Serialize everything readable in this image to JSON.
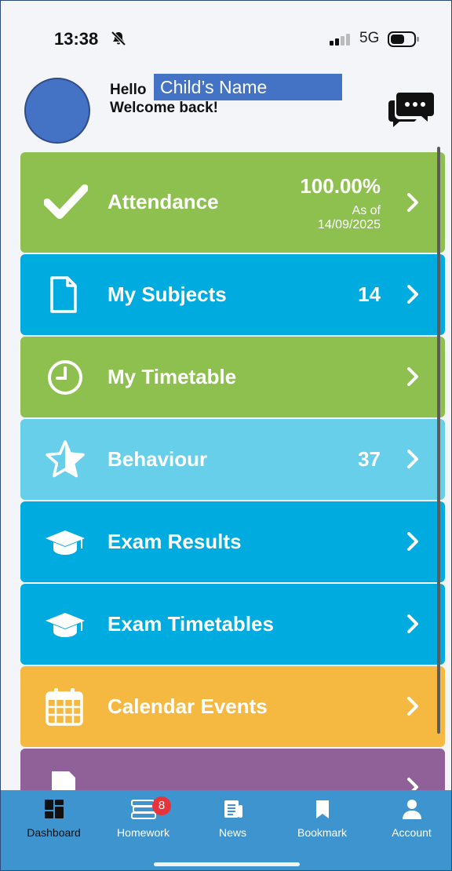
{
  "status_bar": {
    "time": "13:38",
    "network": "5G"
  },
  "header": {
    "greeting": "Hello",
    "child_name": "Child’s Name",
    "welcome": "Welcome back!"
  },
  "menu": {
    "attendance": {
      "label": "Attendance",
      "percent": "100.00%",
      "as_of": "As of",
      "date": "14/09/2025",
      "color": "#8dc04f"
    },
    "subjects": {
      "label": "My Subjects",
      "count": "14",
      "color": "#00abe0"
    },
    "timetable": {
      "label": "My Timetable",
      "color": "#8dc04f"
    },
    "behaviour": {
      "label": "Behaviour",
      "count": "37",
      "color": "#67cfe9"
    },
    "exam_results": {
      "label": "Exam Results",
      "color": "#00abe0"
    },
    "exam_timetables": {
      "label": "Exam Timetables",
      "color": "#00abe0"
    },
    "calendar": {
      "label": "Calendar Events",
      "color": "#f5b942"
    },
    "partial_row_color": "#8f6198"
  },
  "tabbar": {
    "dashboard": "Dashboard",
    "homework": "Homework",
    "homework_badge": "8",
    "news": "News",
    "bookmark": "Bookmark",
    "account": "Account"
  }
}
